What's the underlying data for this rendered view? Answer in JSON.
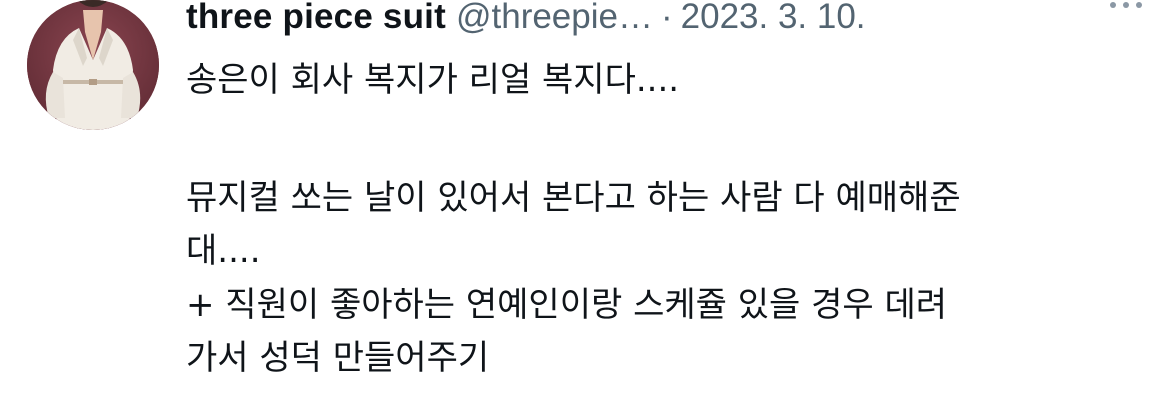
{
  "tweet": {
    "display_name": "three piece suit",
    "handle": "@threepie…",
    "separator": "·",
    "date": "2023. 3. 10.",
    "more_icon": "more-horizontal-icon",
    "avatar_icon": "profile-avatar",
    "text": {
      "p1": "송은이 회사 복지가 리얼 복지다....",
      "p2_l1": "뮤지컬 쏘는 날이 있어서 본다고 하는 사람 다 예매해준",
      "p2_l2": "대....",
      "p3_l1": "+ 직원이 좋아하는 연예인이랑 스케쥴 있을 경우 데려",
      "p3_l2": "가서 성덕 만들어주기"
    }
  }
}
